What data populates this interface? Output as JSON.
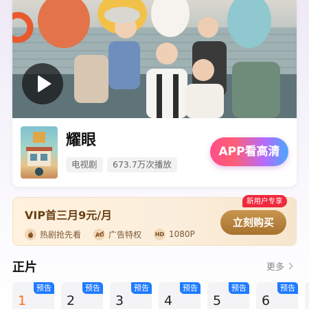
{
  "show": {
    "title": "耀眼",
    "genre": "电视剧",
    "plays": "673.7万次播放",
    "app_button_label": "APP看高清"
  },
  "vip": {
    "title": "VIP首三月9元/月",
    "perks": [
      {
        "icon": "fire-icon",
        "label": "热剧抢先看"
      },
      {
        "icon": "ad-icon",
        "label": "广告特权"
      },
      {
        "icon": "hd-icon",
        "icon_text": "HD",
        "label": "1080P"
      }
    ],
    "buy_label": "立刻购买",
    "badge": "新用户专享"
  },
  "episodes": {
    "section_title": "正片",
    "more_label": "更多",
    "items": [
      {
        "number": "1",
        "badge": "预告",
        "current": true
      },
      {
        "number": "2",
        "badge": "预告"
      },
      {
        "number": "3",
        "badge": "预告"
      },
      {
        "number": "4",
        "badge": "预告"
      },
      {
        "number": "5",
        "badge": "预告"
      },
      {
        "number": "6",
        "badge": "预告"
      }
    ]
  },
  "colors": {
    "accent_orange": "#ff6a13",
    "badge_blue": "#1f7bff",
    "vip_gold": "#a8722f",
    "new_user_red": "#f0283d"
  }
}
